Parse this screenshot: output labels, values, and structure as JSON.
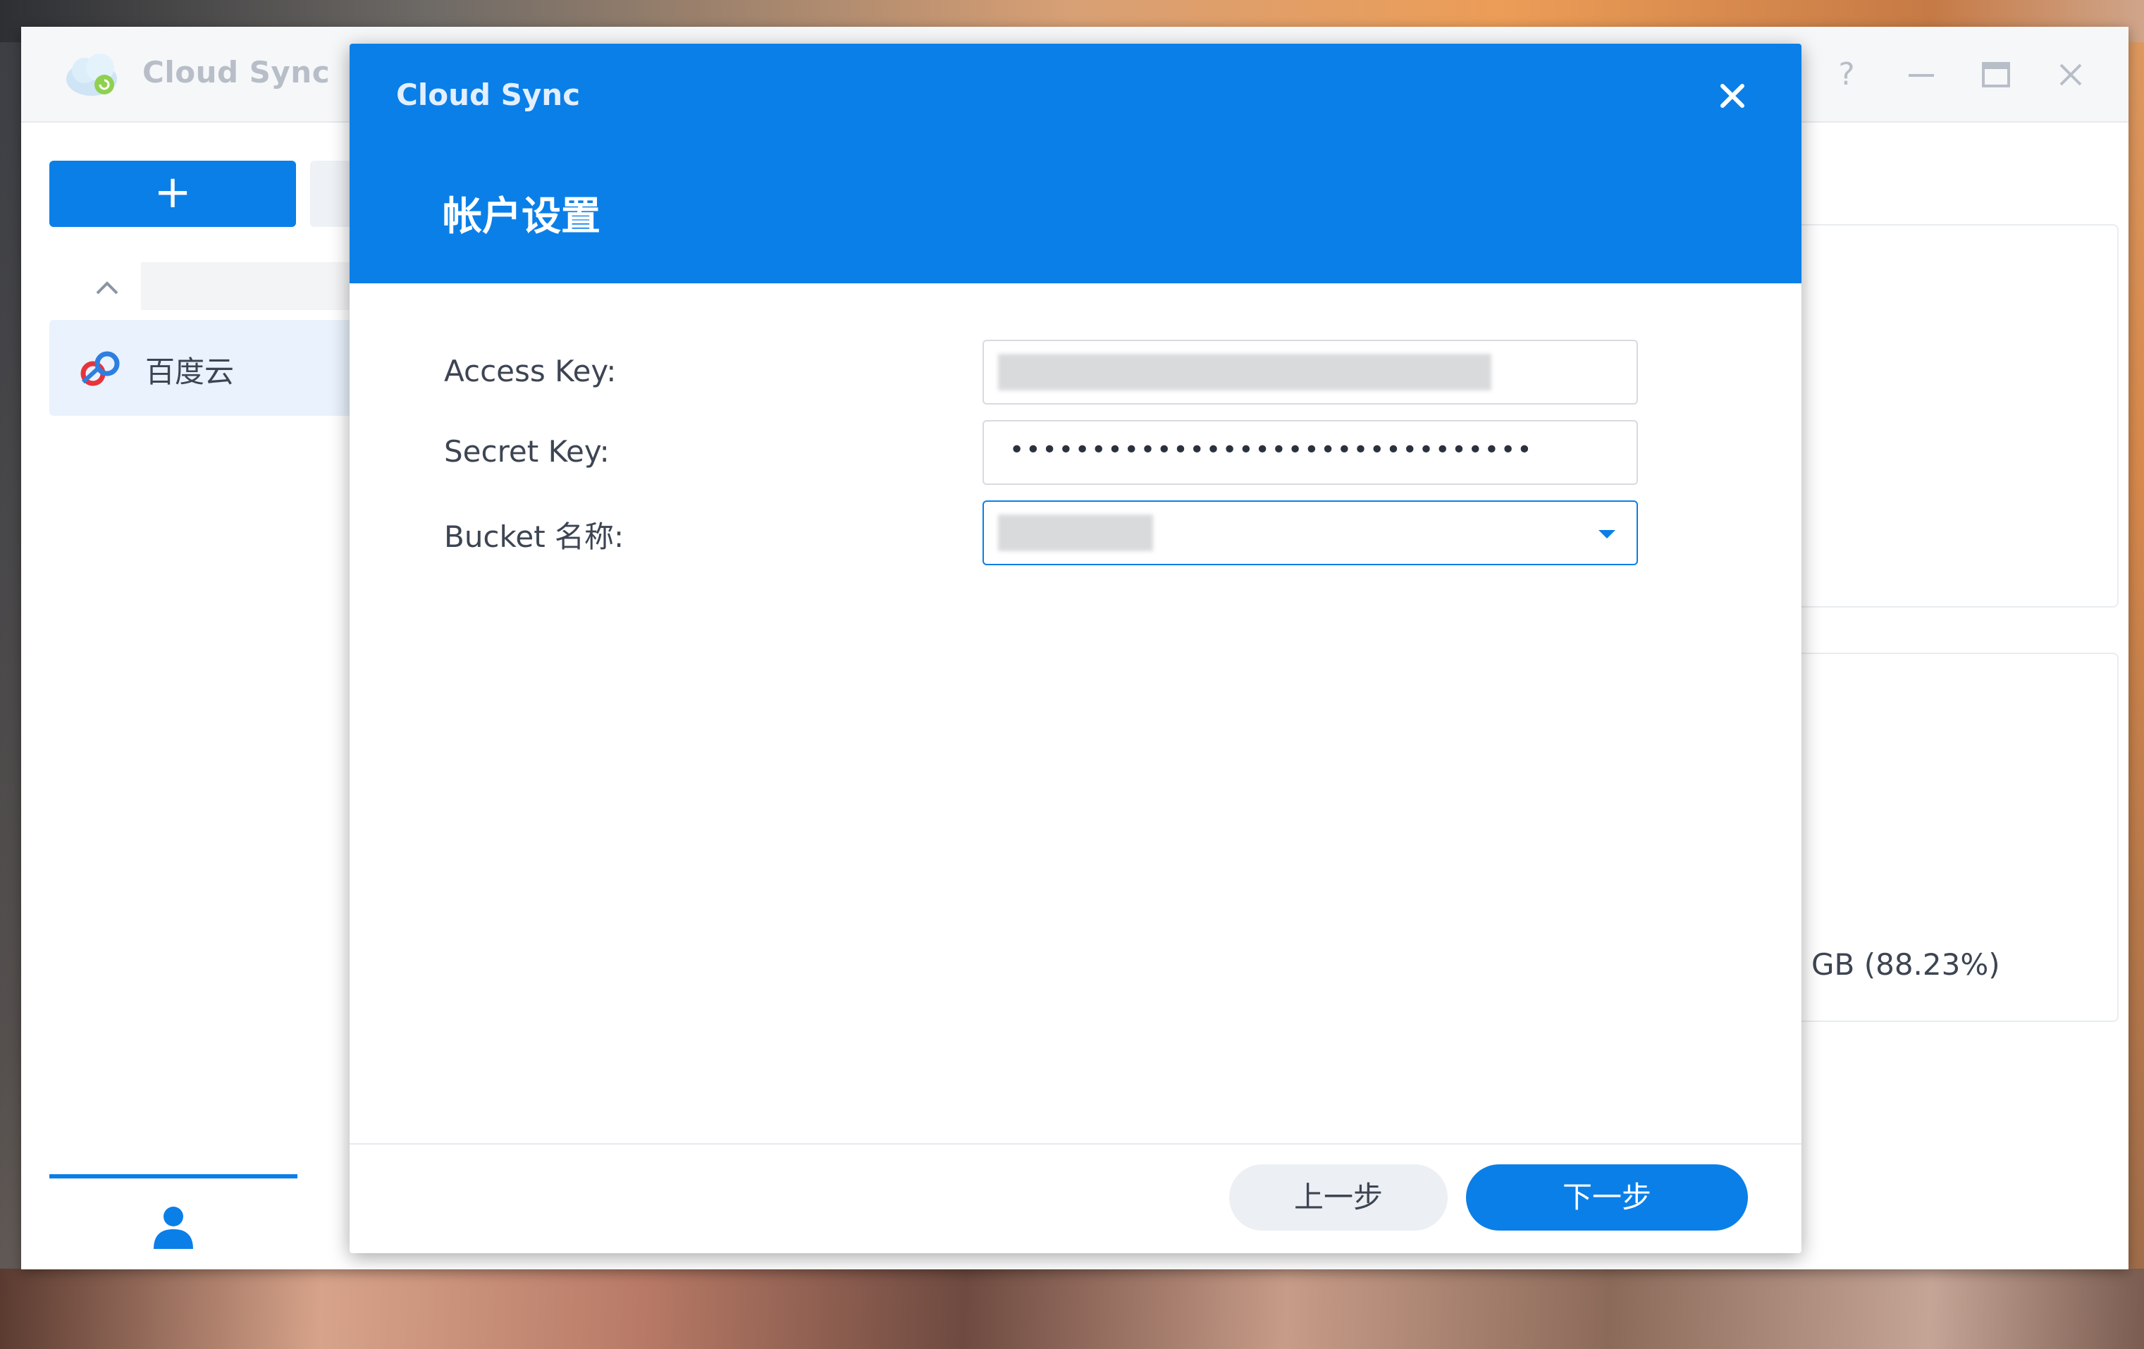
{
  "app": {
    "title": "Cloud Sync",
    "help_icon": "?",
    "add_button_label": "+",
    "sidebar": {
      "items": [
        {
          "label": "百度云",
          "icon": "baidu-cloud-icon",
          "selected": true
        }
      ]
    },
    "usage_text": "GB (88.23%)"
  },
  "dialog": {
    "title": "Cloud Sync",
    "subtitle": "帐户设置",
    "fields": [
      {
        "label": "Access Key:",
        "value": "",
        "type": "text",
        "obscured": true
      },
      {
        "label": "Secret Key:",
        "value": "••••••••••••••••••••••••••••••••",
        "type": "password"
      },
      {
        "label": "Bucket 名称:",
        "value": "",
        "type": "select",
        "obscured": true
      }
    ],
    "buttons": {
      "prev": "上一步",
      "next": "下一步"
    }
  },
  "colors": {
    "accent": "#0a7fe8",
    "header_text_muted": "#e3efff",
    "text": "#3d4553"
  }
}
